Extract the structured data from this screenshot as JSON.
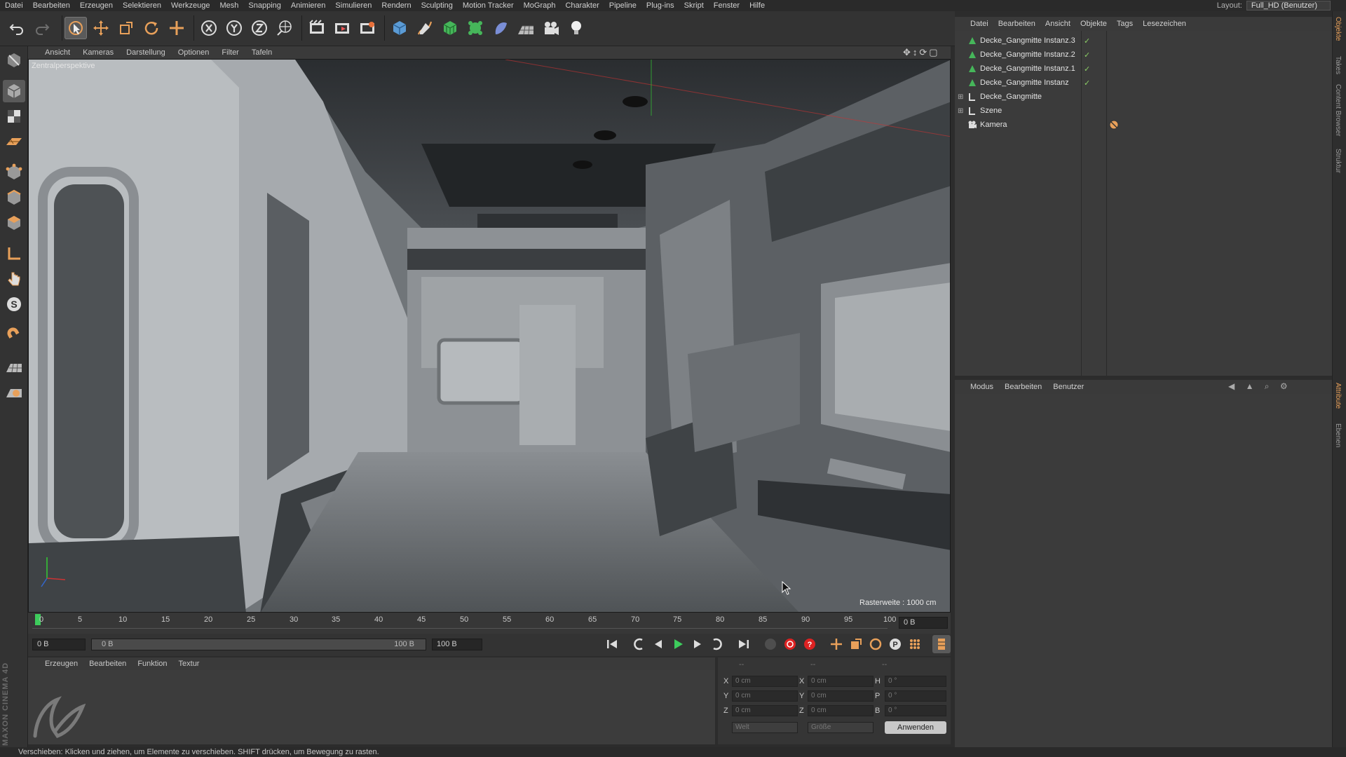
{
  "menubar": {
    "items": [
      "Datei",
      "Bearbeiten",
      "Erzeugen",
      "Selektieren",
      "Werkzeuge",
      "Mesh",
      "Snapping",
      "Animieren",
      "Simulieren",
      "Rendern",
      "Sculpting",
      "Motion Tracker",
      "MoGraph",
      "Charakter",
      "Pipeline",
      "Plug-ins",
      "Skript",
      "Fenster",
      "Hilfe"
    ],
    "layout_label": "Layout:",
    "layout_value": "Full_HD (Benutzer)"
  },
  "toolbar": {
    "icons": [
      "undo-icon",
      "redo-icon",
      "live-select-icon",
      "move-icon",
      "scale-icon",
      "rotate-icon",
      "last-tool-icon",
      "x-axis-icon",
      "y-axis-icon",
      "z-axis-icon",
      "world-coords-icon",
      "render-view-icon",
      "render-picture-viewer-icon",
      "render-settings-icon",
      "cube-icon",
      "spline-pen-icon",
      "subdivision-icon",
      "cloner-icon",
      "deformer-icon",
      "floor-icon",
      "camera-icon",
      "light-icon"
    ]
  },
  "leftbar": {
    "icons": [
      "make-editable-icon",
      "model-mode-icon",
      "texture-mode-icon",
      "workplane-icon",
      "points-mode-icon",
      "edges-mode-icon",
      "polygons-mode-icon",
      "axis-mode-icon",
      "tweak-icon",
      "snap-icon",
      "magnet-icon",
      "grid-snap-icon",
      "paint-icon"
    ]
  },
  "viewport": {
    "menu": [
      "Ansicht",
      "Kameras",
      "Darstellung",
      "Optionen",
      "Filter",
      "Tafeln"
    ],
    "label": "Zentralperspektive",
    "grid": "Rasterweite : 1000 cm"
  },
  "timeline": {
    "ticks": [
      "0",
      "5",
      "10",
      "15",
      "20",
      "25",
      "30",
      "35",
      "40",
      "45",
      "50",
      "55",
      "60",
      "65",
      "70",
      "75",
      "80",
      "85",
      "90",
      "95",
      "100"
    ],
    "current_frame_field": "0 B",
    "start_field": "0 B",
    "range_start": "0 B",
    "range_end": "100 B",
    "end_field": "100 B",
    "right_field": "0 B"
  },
  "materials": {
    "menu": [
      "Erzeugen",
      "Bearbeiten",
      "Funktion",
      "Textur"
    ],
    "logo_text": "MAXON CINEMA 4D"
  },
  "coords": {
    "headers": [
      "--",
      "--",
      "--"
    ],
    "rows": [
      {
        "a": "X",
        "av": "0 cm",
        "b": "X",
        "bv": "0 cm",
        "c": "H",
        "cv": "0 °"
      },
      {
        "a": "Y",
        "av": "0 cm",
        "b": "Y",
        "bv": "0 cm",
        "c": "P",
        "cv": "0 °"
      },
      {
        "a": "Z",
        "av": "0 cm",
        "b": "Z",
        "bv": "0 cm",
        "c": "B",
        "cv": "0 °"
      }
    ],
    "mode1": "Welt",
    "mode2": "Größe",
    "apply": "Anwenden"
  },
  "objects": {
    "menu": [
      "Datei",
      "Bearbeiten",
      "Ansicht",
      "Objekte",
      "Tags",
      "Lesezeichen"
    ],
    "items": [
      {
        "name": "Decke_Gangmitte Instanz.3",
        "type": "instance",
        "check": "✓"
      },
      {
        "name": "Decke_Gangmitte Instanz.2",
        "type": "instance",
        "check": "✓"
      },
      {
        "name": "Decke_Gangmitte Instanz.1",
        "type": "instance",
        "check": "✓"
      },
      {
        "name": "Decke_Gangmitte Instanz",
        "type": "instance",
        "check": "✓"
      },
      {
        "name": "Decke_Gangmitte",
        "type": "null",
        "check": ""
      },
      {
        "name": "Szene",
        "type": "null",
        "check": ""
      },
      {
        "name": "Kamera",
        "type": "camera",
        "check": ""
      }
    ]
  },
  "attributes": {
    "menu": [
      "Modus",
      "Bearbeiten",
      "Benutzer"
    ]
  },
  "right_tabs": [
    "Objekte",
    "Takes",
    "Content Browser",
    "Struktur",
    "Attribute",
    "Ebenen"
  ],
  "status": "Verschieben: Klicken und ziehen, um Elemente zu verschieben. SHIFT drücken, um Bewegung zu rasten.",
  "colors": {
    "accent": "#e8a05a",
    "check": "#8ccf66",
    "keyframe": "#3dcc5c"
  }
}
